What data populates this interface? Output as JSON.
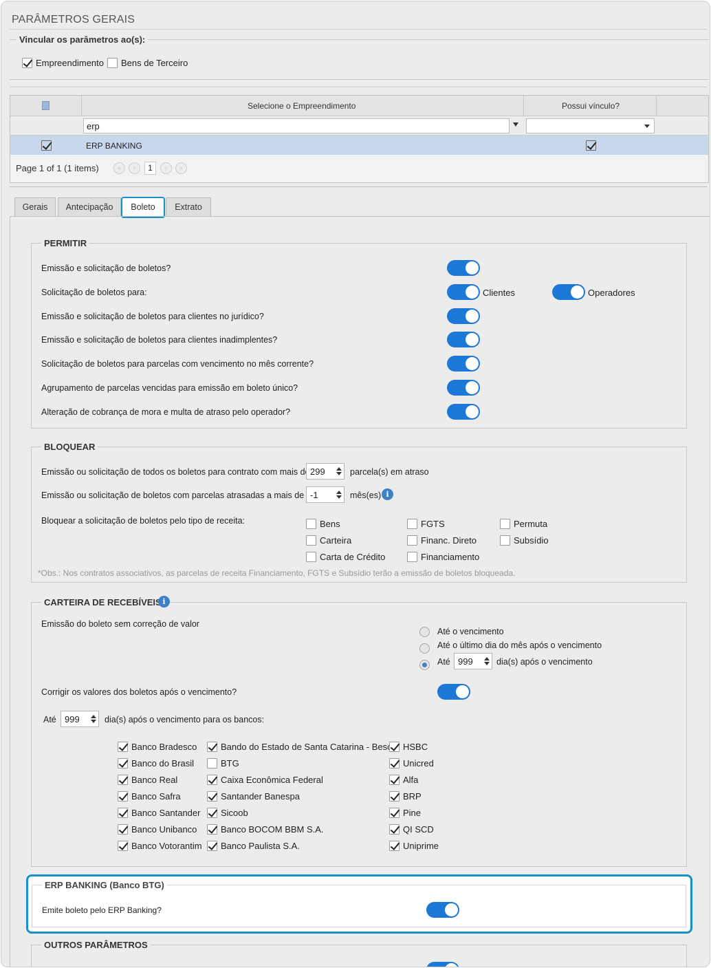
{
  "page": {
    "title": "PARÂMETROS GERAIS"
  },
  "vinculo": {
    "legend": "Vincular os parâmetros ao(s):",
    "options": [
      {
        "label": "Empreendimento",
        "checked": true
      },
      {
        "label": "Bens de Terceiro",
        "checked": false
      }
    ]
  },
  "grid": {
    "header_col1": "Selecione o Empreendimento",
    "header_col2": "Possui vínculo?",
    "filter_value": "erp",
    "rows": [
      {
        "name": "ERP BANKING",
        "selected": true,
        "possui_vinculo": true
      }
    ],
    "pager_text": "Page 1 of 1 (1 items)",
    "current_page": "1"
  },
  "tabs": [
    {
      "label": "Gerais",
      "active": false
    },
    {
      "label": "Antecipação",
      "active": false
    },
    {
      "label": "Boleto",
      "active": true
    },
    {
      "label": "Extrato",
      "active": false
    }
  ],
  "permitir": {
    "legend": "PERMITIR",
    "items": [
      {
        "label": "Emissão e solicitação de boletos?",
        "on": true
      },
      {
        "label": "Solicitação de boletos para:",
        "on": true,
        "toggle_label": "Clientes",
        "toggle2_label": "Operadores"
      },
      {
        "label": "Emissão e solicitação de boletos para clientes no jurídico?",
        "on": true
      },
      {
        "label": "Emissão e solicitação de boletos para clientes inadimplentes?",
        "on": true
      },
      {
        "label": "Solicitação de boletos para parcelas com vencimento no mês corrente?",
        "on": true
      },
      {
        "label": "Agrupamento de parcelas vencidas para emissão em boleto único?",
        "on": true
      },
      {
        "label": "Alteração de cobrança de mora e multa de atraso pelo operador?",
        "on": true
      }
    ]
  },
  "bloquear": {
    "legend": "BLOQUEAR",
    "row1": {
      "label": "Emissão ou solicitação de todos os boletos para contrato com mais de",
      "value": "299",
      "suffix": "parcela(s) em atraso"
    },
    "row2": {
      "label": "Emissão ou solicitação de boletos com parcelas atrasadas a mais de",
      "value": "-1",
      "suffix": "mês(es)"
    },
    "tipo_label": "Bloquear a solicitação de boletos pelo tipo de receita:",
    "tipos": [
      {
        "label": "Bens",
        "checked": false
      },
      {
        "label": "Carteira",
        "checked": false
      },
      {
        "label": "Carta de Crédito",
        "checked": false
      },
      {
        "label": "FGTS",
        "checked": false
      },
      {
        "label": "Financ. Direto",
        "checked": false
      },
      {
        "label": "Financiamento",
        "checked": false
      },
      {
        "label": "Permuta",
        "checked": false
      },
      {
        "label": "Subsídio",
        "checked": false
      }
    ],
    "obs": "*Obs.: Nos contratos associativos, as parcelas de receita Financiamento, FGTS e Subsídio terão a emissão de boletos bloqueada."
  },
  "carteira": {
    "legend": "CARTEIRA DE RECEBÍVEIS",
    "emissao_label": "Emissão do boleto sem correção de valor",
    "radios": [
      {
        "label": "Até o vencimento",
        "selected": false
      },
      {
        "label": "Até o último dia do mês após o vencimento",
        "selected": false
      },
      {
        "label": "Até",
        "selected": true,
        "value": "999",
        "suffix": "dia(s) após o vencimento"
      }
    ],
    "corrigir_label": "Corrigir os valores dos boletos após o vencimento?",
    "corrigir_on": true,
    "ate_label": "Até",
    "ate_value": "999",
    "ate_suffix": "dia(s) após o vencimento para os bancos:",
    "bancos": [
      {
        "label": "Banco Bradesco",
        "checked": true
      },
      {
        "label": "Banco do Brasil",
        "checked": true
      },
      {
        "label": "Banco Real",
        "checked": true
      },
      {
        "label": "Banco Safra",
        "checked": true
      },
      {
        "label": "Banco Santander",
        "checked": true
      },
      {
        "label": "Banco Unibanco",
        "checked": true
      },
      {
        "label": "Banco Votorantim",
        "checked": true
      },
      {
        "label": "Bando do Estado de Santa Catarina - Besc",
        "checked": true
      },
      {
        "label": "BTG",
        "checked": false
      },
      {
        "label": "Caixa Econômica Federal",
        "checked": true
      },
      {
        "label": "Santander Banespa",
        "checked": true
      },
      {
        "label": "Sicoob",
        "checked": true
      },
      {
        "label": "Banco BOCOM BBM S.A.",
        "checked": true
      },
      {
        "label": "Banco Paulista S.A.",
        "checked": true
      },
      {
        "label": "HSBC",
        "checked": true
      },
      {
        "label": "Unicred",
        "checked": true
      },
      {
        "label": "Alfa",
        "checked": true
      },
      {
        "label": "BRP",
        "checked": true
      },
      {
        "label": "Pine",
        "checked": true
      },
      {
        "label": "QI SCD",
        "checked": true
      },
      {
        "label": "Uniprime",
        "checked": true
      }
    ]
  },
  "erp_banking": {
    "legend": "ERP BANKING (Banco BTG)",
    "label": "Emite boleto pelo ERP Banking?",
    "on": true
  },
  "outros": {
    "legend": "OUTROS PARÂMETROS"
  },
  "colors": {
    "toggle": "#1b78d6",
    "highlight": "#1792c9",
    "selected_row": "#c8d7ee"
  }
}
